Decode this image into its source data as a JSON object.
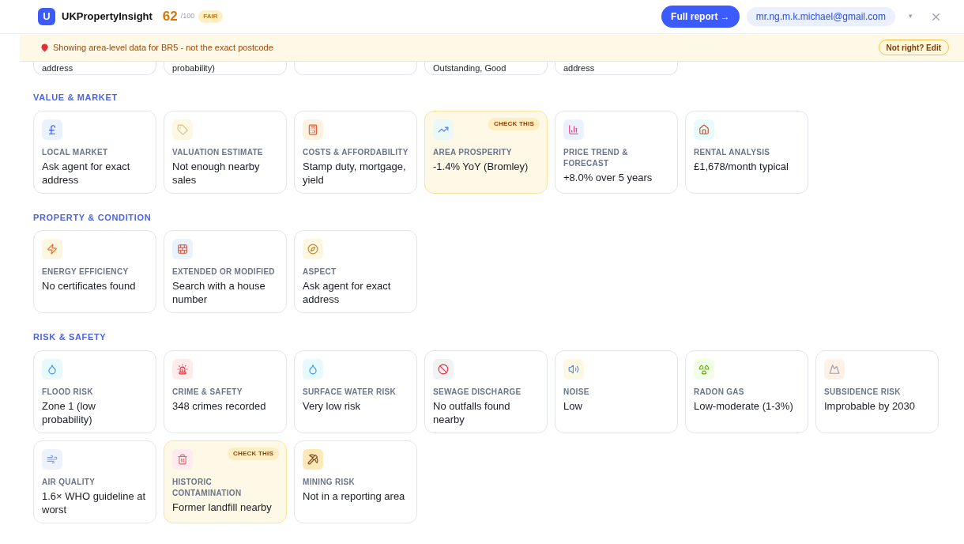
{
  "header": {
    "logo": "U",
    "brand": "UKPropertyInsight",
    "score": "62",
    "score_max": "/100",
    "rating": "FAIR",
    "report_button": "Full report →",
    "account": "mr.ng.m.k.michael@gmail.com",
    "caret": "▾"
  },
  "banner": {
    "text": "Showing area-level data for BR5 - not the exact postcode",
    "button": "Not right? Edit"
  },
  "partial_cards": [
    {
      "kind": "text",
      "value": "address"
    },
    {
      "kind": "text",
      "value": "probability)"
    },
    {
      "kind": "blank"
    },
    {
      "kind": "text",
      "value": "Outstanding, Good"
    },
    {
      "kind": "text",
      "value": "address"
    }
  ],
  "sections": [
    {
      "title": "VALUE & MARKET",
      "cards": [
        {
          "kind": "pound",
          "label": "LOCAL MARKET",
          "value": "Ask agent for exact address",
          "flagged": false
        },
        {
          "kind": "tag",
          "label": "VALUATION ESTIMATE",
          "value": "Not enough nearby sales",
          "flagged": false
        },
        {
          "kind": "abacus",
          "label": "COSTS & AFFORDABILITY",
          "value": "Stamp duty, mortgage, yield",
          "flagged": false
        },
        {
          "kind": "trend",
          "label": "AREA PROSPERITY",
          "value": "-1.4% YoY (Bromley)",
          "flagged": true,
          "flag": "CHECK THIS"
        },
        {
          "kind": "bars",
          "label": "PRICE TREND & FORECAST",
          "value": "+8.0% over 5 years",
          "flagged": false
        },
        {
          "kind": "house",
          "label": "RENTAL ANALYSIS",
          "value": "£1,678/month typical",
          "flagged": false
        }
      ]
    },
    {
      "title": "PROPERTY & CONDITION",
      "cards": [
        {
          "kind": "bolt",
          "label": "ENERGY EFFICIENCY",
          "value": "No certificates found",
          "flagged": false
        },
        {
          "kind": "brick",
          "label": "EXTENDED OR MODIFIED",
          "value": "Search with a house number",
          "flagged": false
        },
        {
          "kind": "compass",
          "label": "ASPECT",
          "value": "Ask agent for exact address",
          "flagged": false
        }
      ]
    },
    {
      "title": "RISK & SAFETY",
      "cards": [
        {
          "kind": "drop",
          "label": "FLOOD RISK",
          "value": "Zone 1 (low probability)",
          "flagged": false
        },
        {
          "kind": "siren",
          "label": "CRIME & SAFETY",
          "value": "348 crimes recorded",
          "flagged": false
        },
        {
          "kind": "drop",
          "label": "SURFACE WATER RISK",
          "value": "Very low risk",
          "flagged": false
        },
        {
          "kind": "nosign",
          "label": "SEWAGE DISCHARGE",
          "value": "No outfalls found nearby",
          "flagged": false
        },
        {
          "kind": "speaker",
          "label": "NOISE",
          "value": "Low",
          "flagged": false
        },
        {
          "kind": "radiation",
          "label": "RADON GAS",
          "value": "Low-moderate (1-3%)",
          "flagged": false
        },
        {
          "kind": "rock",
          "label": "SUBSIDENCE RISK",
          "value": "Improbable by 2030",
          "flagged": false
        },
        {
          "kind": "wind",
          "label": "AIR QUALITY",
          "value": "1.6× WHO guideline at worst",
          "flagged": false
        },
        {
          "kind": "bin",
          "label": "HISTORIC CONTAMINATION",
          "value": "Former landfill nearby",
          "flagged": true,
          "flag": "CHECK THIS"
        },
        {
          "kind": "pick",
          "label": "MINING RISK",
          "value": "Not in a reporting area",
          "flagged": false
        }
      ]
    }
  ]
}
